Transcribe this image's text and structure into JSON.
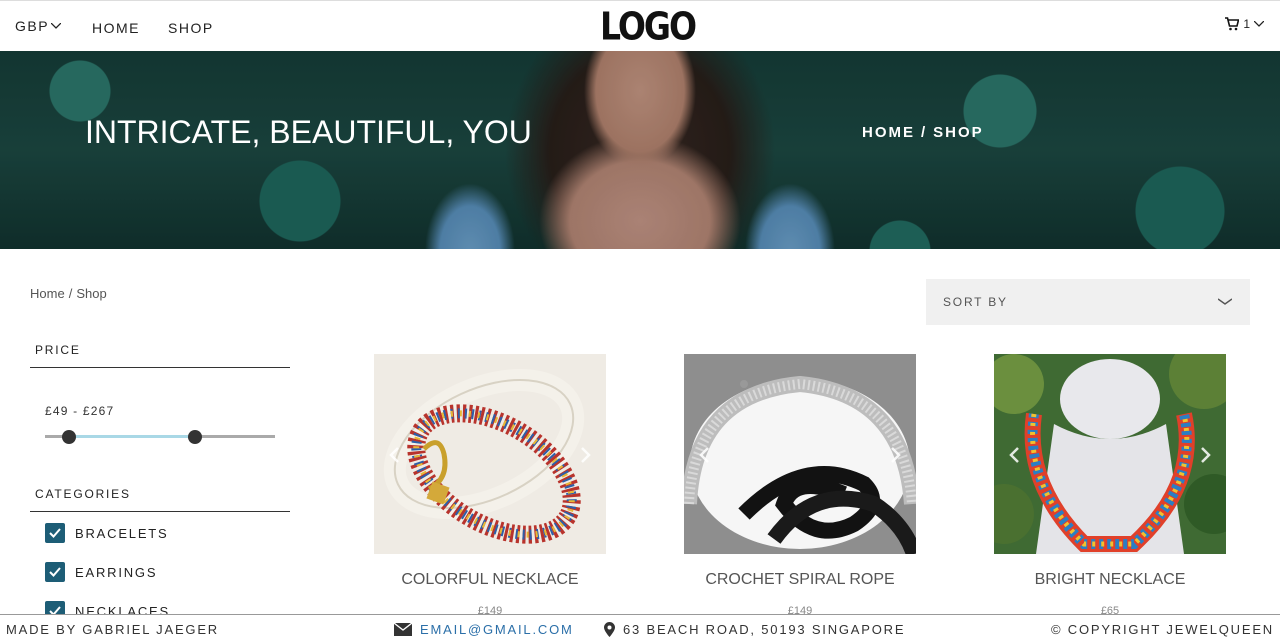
{
  "nav": {
    "currency": "GBP",
    "links": [
      "HOME",
      "SHOP"
    ],
    "logo": "LOGO",
    "cart_count": "1"
  },
  "hero": {
    "title": "INTRICATE, BEAUTIFUL, YOU",
    "crumb_home": "HOME",
    "crumb_sep": "/",
    "crumb_shop": "SHOP"
  },
  "breadcrumb": {
    "home": "Home",
    "sep": "/",
    "shop": "Shop"
  },
  "sort": {
    "label": "SORT BY"
  },
  "sidebar": {
    "price_heading": "PRICE",
    "price_range": "£49 - £267",
    "price_min_fraction": 0.1,
    "price_max_fraction": 0.65,
    "categories_heading": "CATEGORIES",
    "categories": [
      {
        "label": "BRACELETS",
        "checked": true
      },
      {
        "label": "EARRINGS",
        "checked": true
      },
      {
        "label": "NECKLACES",
        "checked": true
      }
    ]
  },
  "products": [
    {
      "name": "COLORFUL NECKLACE",
      "price": "£149"
    },
    {
      "name": "CROCHET SPIRAL ROPE",
      "price": "£149"
    },
    {
      "name": "BRIGHT NECKLACE",
      "price": "£65"
    }
  ],
  "footer": {
    "made_by": "MADE BY GABRIEL JAEGER",
    "email": "EMAIL@GMAIL.COM",
    "address": "63 BEACH ROAD, 50193 SINGAPORE",
    "copyright": "© COPYRIGHT JEWELQUEEN"
  },
  "colors": {
    "checkbox": "#1d5d76",
    "slider_fill": "#a9d8e6",
    "email_link": "#2b6fa8"
  },
  "icons": [
    "chevron-down-icon",
    "cart-icon",
    "envelope-icon",
    "map-pin-icon",
    "check-icon",
    "arrow-left-icon",
    "arrow-right-icon"
  ]
}
